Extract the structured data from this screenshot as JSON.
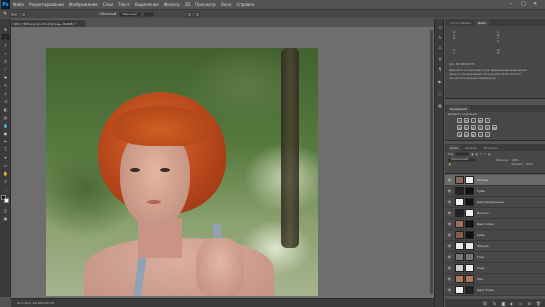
{
  "app": {
    "logo": "Ps"
  },
  "menu": [
    "Файл",
    "Редактирование",
    "Изображение",
    "Слои",
    "Текст",
    "Выделение",
    "Фильтр",
    "3D",
    "Просмотр",
    "Окно",
    "Справка"
  ],
  "window_controls": {
    "minimize": "–",
    "maximize": "□",
    "close": "✕"
  },
  "options_bar": {
    "mode_label": "Обычный",
    "mode_value": "Обычный"
  },
  "document_tab": {
    "title": "DSC_7876.psd @ 21% (Ретушь, RGB/8) *"
  },
  "statusbar": {
    "text": "21%   Док: 46,3M/190,7M"
  },
  "properties_panel": {
    "tabs": [
      "Гистограмма",
      "Инфо"
    ],
    "info_lines": [
      "Док: 46,3M/190,7M",
      "Щелкните и перетащите для перемещения выделенной",
      "области или выделения. Используйте Shift, Alt и Ctrl",
      "для дополнительных параметров."
    ]
  },
  "adjustments_panel": {
    "tab": "Коррекция",
    "subtitle": "Добавить коррекцию"
  },
  "layers_panel": {
    "tabs": [
      "Слои",
      "Каналы",
      "Контуры"
    ],
    "kind_label": "Вид",
    "blend_mode": "Нормальный",
    "opacity_label": "Непрозр.:",
    "opacity_value": "100%",
    "fill_label": "Заливка:",
    "fill_value": "100%",
    "layers": [
      {
        "name": "Ретушь",
        "thumb_color": "#8a6a5a",
        "mask_color": "#eeeeee",
        "selected": true
      },
      {
        "name": "Губы",
        "thumb_color": "#222222",
        "mask_color": "#111111",
        "selected": false
      },
      {
        "name": "Цветокоррекция",
        "thumb_color": "#f0f0f0",
        "mask_color": "#111111",
        "selected": false
      },
      {
        "name": "Волосы",
        "thumb_color": "#222222",
        "mask_color": "#f0f0f0",
        "selected": false
      },
      {
        "name": "Цвет кожи",
        "thumb_color": "#a0705a",
        "mask_color": "#111111",
        "selected": false
      },
      {
        "name": "Губы",
        "thumb_color": "#8a5a4a",
        "mask_color": "#111111",
        "selected": false
      },
      {
        "name": "Фигура",
        "thumb_color": "#e8e8e8",
        "mask_color": "#e8e8e8",
        "selected": false
      },
      {
        "name": "Глаз",
        "thumb_color": "#777777",
        "mask_color": "#777777",
        "selected": false
      },
      {
        "name": "Тень",
        "thumb_color": "#cccccc",
        "mask_color": "#eeeeee",
        "selected": false
      },
      {
        "name": "Фон",
        "thumb_color": "#b07a5a",
        "mask_color": "#b07a5a",
        "selected": false
      },
      {
        "name": "Цвет Кожи",
        "thumb_color": "#eeeeee",
        "mask_color": "#222222",
        "selected": false
      }
    ],
    "footer_icons": [
      "link-icon",
      "fx-icon",
      "mask-icon",
      "adjustment-icon",
      "folder-icon",
      "new-layer-icon",
      "trash-icon"
    ]
  },
  "colors": {
    "ui_bg": "#535353",
    "panel_bg": "#474747",
    "accent_ps": "#31a8ff",
    "hair": "#b8461b"
  }
}
